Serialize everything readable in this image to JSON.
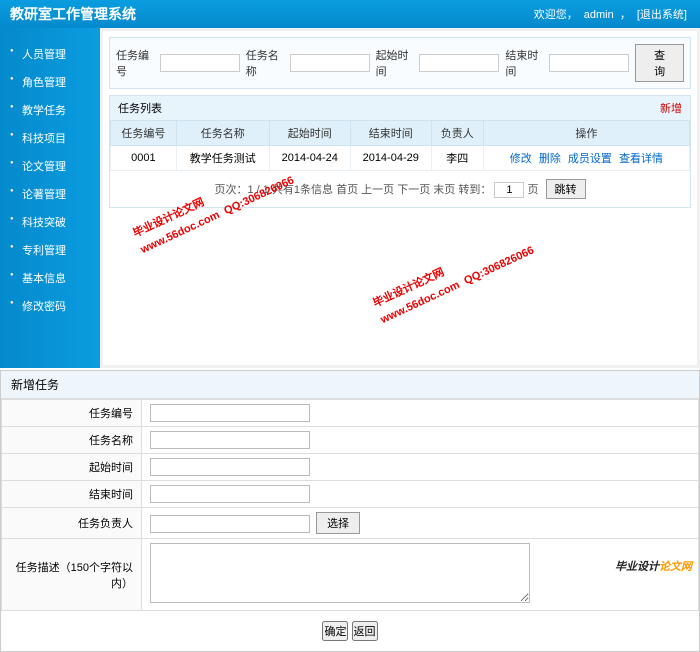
{
  "header": {
    "title": "教研室工作管理系统",
    "welcome": "欢迎您，",
    "user": "admin",
    "logout": "[退出系统]"
  },
  "sidebar": {
    "items": [
      {
        "label": "人员管理"
      },
      {
        "label": "角色管理"
      },
      {
        "label": "教学任务"
      },
      {
        "label": "科技项目"
      },
      {
        "label": "论文管理"
      },
      {
        "label": "论著管理"
      },
      {
        "label": "科技突破"
      },
      {
        "label": "专利管理"
      },
      {
        "label": "基本信息"
      },
      {
        "label": "修改密码"
      }
    ]
  },
  "search": {
    "f1": "任务编号",
    "f2": "任务名称",
    "f3": "起始时间",
    "f4": "结束时间",
    "btn": "查询"
  },
  "list": {
    "title": "任务列表",
    "add": "新增",
    "cols": [
      "任务编号",
      "任务名称",
      "起始时间",
      "结束时间",
      "负责人",
      "操作"
    ],
    "row": {
      "id": "0001",
      "name": "教学任务测试",
      "start": "2014-04-24",
      "end": "2014-04-29",
      "owner": "李四"
    },
    "ops": {
      "a": "修改",
      "b": "删除",
      "c": "成员设置",
      "d": "查看详情"
    }
  },
  "pager": {
    "txt1": "页次：1 / 1 共有1条信息",
    "txt2": "首页 上一页 下一页 末页",
    "txt3": "转到：",
    "unit": "页",
    "val": "1",
    "btn": "跳转"
  },
  "watermark": {
    "l1": "毕业设计论文网",
    "l2": "www.56doc.com",
    "l3": "QQ:306826066"
  },
  "addform": {
    "title": "新增任务",
    "f1": "任务编号",
    "f2": "任务名称",
    "f3": "起始时间",
    "f4": "结束时间",
    "f5": "任务负责人",
    "sel": "选择",
    "f6": "任务描述（150个字符以内）",
    "ok": "确定",
    "back": "返回"
  },
  "brand": {
    "a": "毕业设计",
    "b": "论文网"
  }
}
